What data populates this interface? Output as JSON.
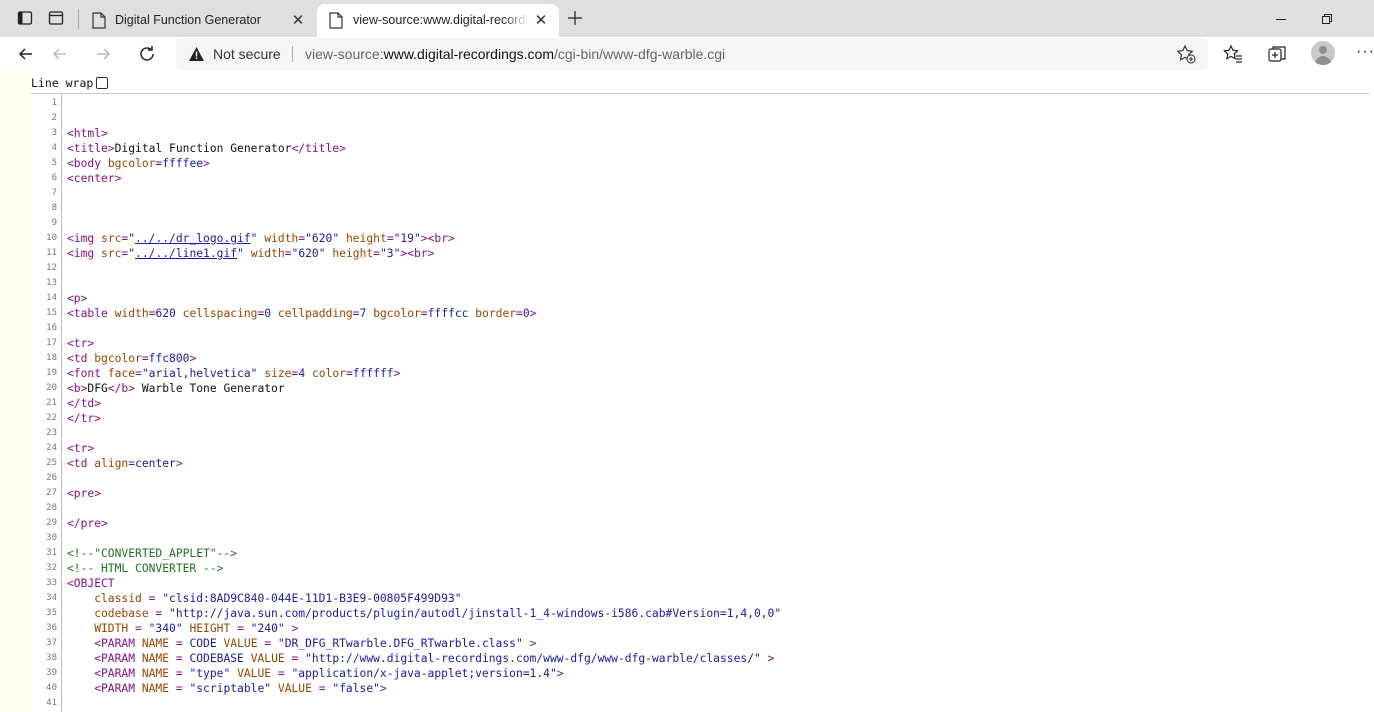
{
  "browser": {
    "tabs": [
      {
        "title": "Digital Function Generator",
        "active": false
      },
      {
        "title": "view-source:www.digital-recordings.com/cgi-bin/www-dfg-warble.cgi",
        "active": true
      }
    ],
    "security_label": "Not secure",
    "url_prefix": "view-source:",
    "url_host": "www.digital-recordings.com",
    "url_path": "/cgi-bin/www-dfg-warble.cgi"
  },
  "viewer": {
    "line_wrap_label": "Line wrap",
    "line_wrap_checked": false
  },
  "source_lines": [
    {
      "n": "1",
      "s": []
    },
    {
      "n": "2",
      "s": []
    },
    {
      "n": "3",
      "s": [
        [
          "tag",
          "<html>"
        ]
      ]
    },
    {
      "n": "4",
      "s": [
        [
          "tag",
          "<title>"
        ],
        [
          "txt",
          "Digital Function Generator"
        ],
        [
          "tag",
          "</title>"
        ]
      ]
    },
    {
      "n": "5",
      "s": [
        [
          "tag",
          "<body "
        ],
        [
          "att",
          "bgcolor"
        ],
        [
          "tag",
          "="
        ],
        [
          "val",
          "ffffee"
        ],
        [
          "tag",
          ">"
        ]
      ]
    },
    {
      "n": "6",
      "s": [
        [
          "tag",
          "<center>"
        ]
      ]
    },
    {
      "n": "7",
      "s": []
    },
    {
      "n": "8",
      "s": []
    },
    {
      "n": "9",
      "s": []
    },
    {
      "n": "10",
      "s": [
        [
          "tag",
          "<img "
        ],
        [
          "att",
          "src"
        ],
        [
          "tag",
          "="
        ],
        [
          "val",
          "\""
        ],
        [
          "lnk",
          "../../dr_logo.gif"
        ],
        [
          "val",
          "\""
        ],
        [
          "tag",
          " "
        ],
        [
          "att",
          "width"
        ],
        [
          "tag",
          "="
        ],
        [
          "val",
          "\"620\""
        ],
        [
          "tag",
          " "
        ],
        [
          "att",
          "height"
        ],
        [
          "tag",
          "="
        ],
        [
          "val",
          "\"19\""
        ],
        [
          "tag",
          "><br>"
        ]
      ]
    },
    {
      "n": "11",
      "s": [
        [
          "tag",
          "<img "
        ],
        [
          "att",
          "src"
        ],
        [
          "tag",
          "="
        ],
        [
          "val",
          "\""
        ],
        [
          "lnk",
          "../../line1.gif"
        ],
        [
          "val",
          "\""
        ],
        [
          "tag",
          " "
        ],
        [
          "att",
          "width"
        ],
        [
          "tag",
          "="
        ],
        [
          "val",
          "\"620\""
        ],
        [
          "tag",
          " "
        ],
        [
          "att",
          "height"
        ],
        [
          "tag",
          "="
        ],
        [
          "val",
          "\"3\""
        ],
        [
          "tag",
          "><br>"
        ]
      ]
    },
    {
      "n": "12",
      "s": []
    },
    {
      "n": "13",
      "s": []
    },
    {
      "n": "14",
      "s": [
        [
          "tag",
          "<p>"
        ]
      ]
    },
    {
      "n": "15",
      "s": [
        [
          "tag",
          "<table "
        ],
        [
          "att",
          "width"
        ],
        [
          "tag",
          "="
        ],
        [
          "val",
          "620"
        ],
        [
          "tag",
          " "
        ],
        [
          "att",
          "cellspacing"
        ],
        [
          "tag",
          "="
        ],
        [
          "val",
          "0"
        ],
        [
          "tag",
          " "
        ],
        [
          "att",
          "cellpadding"
        ],
        [
          "tag",
          "="
        ],
        [
          "val",
          "7"
        ],
        [
          "tag",
          " "
        ],
        [
          "att",
          "bgcolor"
        ],
        [
          "tag",
          "="
        ],
        [
          "val",
          "ffffcc"
        ],
        [
          "tag",
          " "
        ],
        [
          "att",
          "border"
        ],
        [
          "tag",
          "="
        ],
        [
          "val",
          "0"
        ],
        [
          "tag",
          ">"
        ]
      ]
    },
    {
      "n": "16",
      "s": []
    },
    {
      "n": "17",
      "s": [
        [
          "tag",
          "<tr>"
        ]
      ]
    },
    {
      "n": "18",
      "s": [
        [
          "tag",
          "<td "
        ],
        [
          "att",
          "bgcolor"
        ],
        [
          "tag",
          "="
        ],
        [
          "val",
          "ffc800"
        ],
        [
          "tag",
          ">"
        ]
      ]
    },
    {
      "n": "19",
      "s": [
        [
          "tag",
          "<font "
        ],
        [
          "att",
          "face"
        ],
        [
          "tag",
          "="
        ],
        [
          "val",
          "\"arial,helvetica\""
        ],
        [
          "tag",
          " "
        ],
        [
          "att",
          "size"
        ],
        [
          "tag",
          "="
        ],
        [
          "val",
          "4"
        ],
        [
          "tag",
          " "
        ],
        [
          "att",
          "color"
        ],
        [
          "tag",
          "="
        ],
        [
          "val",
          "ffffff"
        ],
        [
          "tag",
          ">"
        ]
      ]
    },
    {
      "n": "20",
      "s": [
        [
          "tag",
          "<b>"
        ],
        [
          "txt",
          "DFG"
        ],
        [
          "tag",
          "</b>"
        ],
        [
          "txt",
          " Warble Tone Generator"
        ]
      ]
    },
    {
      "n": "21",
      "s": [
        [
          "tag",
          "</td>"
        ]
      ]
    },
    {
      "n": "22",
      "s": [
        [
          "tag",
          "</tr>"
        ]
      ]
    },
    {
      "n": "23",
      "s": []
    },
    {
      "n": "24",
      "s": [
        [
          "tag",
          "<tr>"
        ]
      ]
    },
    {
      "n": "25",
      "s": [
        [
          "tag",
          "<td "
        ],
        [
          "att",
          "align"
        ],
        [
          "tag",
          "="
        ],
        [
          "val",
          "center"
        ],
        [
          "tag",
          ">"
        ]
      ]
    },
    {
      "n": "26",
      "s": []
    },
    {
      "n": "27",
      "s": [
        [
          "tag",
          "<pre>"
        ]
      ]
    },
    {
      "n": "28",
      "s": []
    },
    {
      "n": "29",
      "s": [
        [
          "tag",
          "</pre>"
        ]
      ]
    },
    {
      "n": "30",
      "s": []
    },
    {
      "n": "31",
      "s": [
        [
          "cmt",
          "<!--\"CONVERTED_APPLET\"-->"
        ]
      ]
    },
    {
      "n": "32",
      "s": [
        [
          "cmt",
          "<!-- HTML CONVERTER -->"
        ]
      ]
    },
    {
      "n": "33",
      "s": [
        [
          "tag",
          "<OBJECT"
        ]
      ]
    },
    {
      "n": "34",
      "s": [
        [
          "att",
          "    classid"
        ],
        [
          "tag",
          " = "
        ],
        [
          "val",
          "\"clsid:8AD9C840-044E-11D1-B3E9-00805F499D93\""
        ]
      ]
    },
    {
      "n": "35",
      "s": [
        [
          "att",
          "    codebase"
        ],
        [
          "tag",
          " = "
        ],
        [
          "val",
          "\"http://java.sun.com/products/plugin/autodl/jinstall-1_4-windows-i586.cab#Version=1,4,0,0\""
        ]
      ]
    },
    {
      "n": "36",
      "s": [
        [
          "att",
          "    WIDTH"
        ],
        [
          "tag",
          " = "
        ],
        [
          "val",
          "\"340\""
        ],
        [
          "tag",
          " "
        ],
        [
          "att",
          "HEIGHT"
        ],
        [
          "tag",
          " = "
        ],
        [
          "val",
          "\"240\""
        ],
        [
          "tag",
          " >"
        ]
      ]
    },
    {
      "n": "37",
      "s": [
        [
          "tag",
          "    <PARAM "
        ],
        [
          "att",
          "NAME"
        ],
        [
          "tag",
          " = "
        ],
        [
          "val",
          "CODE"
        ],
        [
          "tag",
          " "
        ],
        [
          "att",
          "VALUE"
        ],
        [
          "tag",
          " = "
        ],
        [
          "val",
          "\"DR_DFG_RTwarble.DFG_RTwarble.class\""
        ],
        [
          "tag",
          " >"
        ]
      ]
    },
    {
      "n": "38",
      "s": [
        [
          "tag",
          "    <PARAM "
        ],
        [
          "att",
          "NAME"
        ],
        [
          "tag",
          " = "
        ],
        [
          "val",
          "CODEBASE"
        ],
        [
          "tag",
          " "
        ],
        [
          "att",
          "VALUE"
        ],
        [
          "tag",
          " = "
        ],
        [
          "val",
          "\"http://www.digital-recordings.com/www-dfg/www-dfg-warble/classes/\""
        ],
        [
          "tag",
          " >"
        ]
      ]
    },
    {
      "n": "39",
      "s": [
        [
          "tag",
          "    <PARAM "
        ],
        [
          "att",
          "NAME"
        ],
        [
          "tag",
          " = "
        ],
        [
          "val",
          "\"type\""
        ],
        [
          "tag",
          " "
        ],
        [
          "att",
          "VALUE"
        ],
        [
          "tag",
          " = "
        ],
        [
          "val",
          "\"application/x-java-applet;version=1.4\""
        ],
        [
          "tag",
          ">"
        ]
      ]
    },
    {
      "n": "40",
      "s": [
        [
          "tag",
          "    <PARAM "
        ],
        [
          "att",
          "NAME"
        ],
        [
          "tag",
          " = "
        ],
        [
          "val",
          "\"scriptable\""
        ],
        [
          "tag",
          " "
        ],
        [
          "att",
          "VALUE"
        ],
        [
          "tag",
          " = "
        ],
        [
          "val",
          "\"false\""
        ],
        [
          "tag",
          ">"
        ]
      ]
    },
    {
      "n": "41",
      "s": []
    }
  ]
}
